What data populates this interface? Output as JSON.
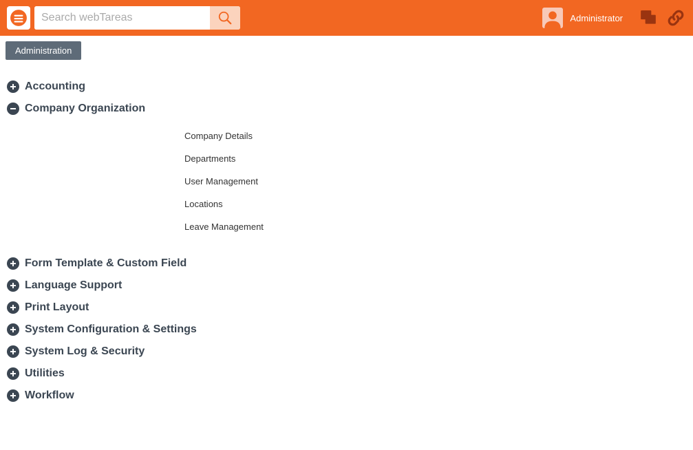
{
  "header": {
    "search_placeholder": "Search webTareas",
    "user_label": "Administrator"
  },
  "breadcrumb": {
    "label": "Administration"
  },
  "sections": [
    {
      "title": "Accounting",
      "expanded": false
    },
    {
      "title": "Company Organization",
      "expanded": true,
      "items": [
        {
          "label": "Company Details"
        },
        {
          "label": "Departments"
        },
        {
          "label": "User Management"
        },
        {
          "label": "Locations"
        },
        {
          "label": "Leave Management"
        }
      ]
    },
    {
      "title": "Form Template & Custom Field",
      "expanded": false
    },
    {
      "title": "Language Support",
      "expanded": false
    },
    {
      "title": "Print Layout",
      "expanded": false
    },
    {
      "title": "System Configuration & Settings",
      "expanded": false
    },
    {
      "title": "System Log & Security",
      "expanded": false
    },
    {
      "title": "Utilities",
      "expanded": false
    },
    {
      "title": "Workflow",
      "expanded": false
    }
  ]
}
